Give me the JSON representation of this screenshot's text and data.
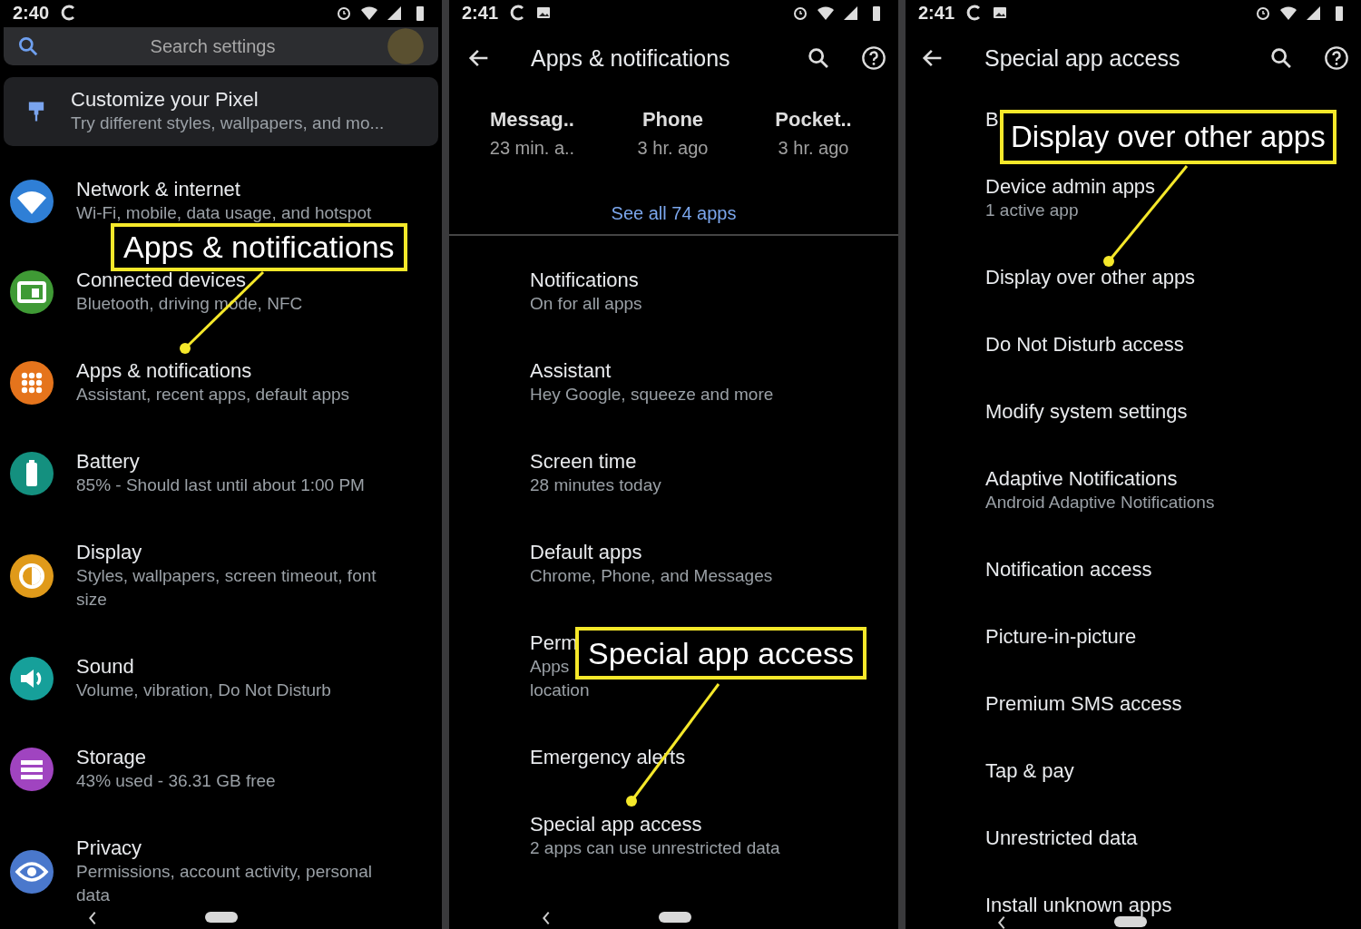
{
  "settings_screen": {
    "status_bar": {
      "time": "2:40"
    },
    "search": {
      "placeholder": "Search settings"
    },
    "banner": {
      "title": "Customize your Pixel",
      "subtitle": "Try different styles, wallpapers, and mo..."
    },
    "items": [
      {
        "title": "Network & internet",
        "subtitle": "Wi-Fi, mobile, data usage, and hotspot",
        "color": "#2f7fd6"
      },
      {
        "title": "Connected devices",
        "subtitle": "Bluetooth, driving mode, NFC",
        "color": "#3f9a35"
      },
      {
        "title": "Apps & notifications",
        "subtitle": "Assistant, recent apps, default apps",
        "color": "#e5741c"
      },
      {
        "title": "Battery",
        "subtitle": "85% - Should last until about 1:00 PM",
        "color": "#14907f"
      },
      {
        "title": "Display",
        "subtitle": "Styles, wallpapers, screen timeout, font size",
        "color": "#e09a1a"
      },
      {
        "title": "Sound",
        "subtitle": "Volume, vibration, Do Not Disturb",
        "color": "#16a09a"
      },
      {
        "title": "Storage",
        "subtitle": "43% used - 36.31 GB free",
        "color": "#a044c0"
      },
      {
        "title": "Privacy",
        "subtitle": "Permissions, account activity, personal data",
        "color": "#4a78cc"
      }
    ]
  },
  "apps_screen": {
    "status_bar": {
      "time": "2:41"
    },
    "title": "Apps & notifications",
    "recent_apps": [
      {
        "name": "Messag..",
        "time": "23 min. a.."
      },
      {
        "name": "Phone",
        "time": "3 hr. ago"
      },
      {
        "name": "Pocket..",
        "time": "3 hr. ago"
      }
    ],
    "see_all": "See all 74 apps",
    "items": [
      {
        "title": "Notifications",
        "subtitle": "On for all apps"
      },
      {
        "title": "Assistant",
        "subtitle": "Hey Google, squeeze and more"
      },
      {
        "title": "Screen time",
        "subtitle": "28 minutes today"
      },
      {
        "title": "Default apps",
        "subtitle": "Chrome, Phone, and Messages"
      },
      {
        "title": "Perm",
        "subtitle": "Apps\nlocation"
      },
      {
        "title": "Emergency alerts"
      },
      {
        "title": "Special app access",
        "subtitle": "2 apps can use unrestricted data"
      }
    ]
  },
  "special_access_screen": {
    "status_bar": {
      "time": "2:41"
    },
    "title": "Special app access",
    "items": [
      {
        "title": "B"
      },
      {
        "title": "Device admin apps",
        "subtitle": "1 active app"
      },
      {
        "title": "Display over other apps"
      },
      {
        "title": "Do Not Disturb access"
      },
      {
        "title": "Modify system settings"
      },
      {
        "title": "Adaptive Notifications",
        "subtitle": "Android Adaptive Notifications"
      },
      {
        "title": "Notification access"
      },
      {
        "title": "Picture-in-picture"
      },
      {
        "title": "Premium SMS access"
      },
      {
        "title": "Tap & pay"
      },
      {
        "title": "Unrestricted data"
      },
      {
        "title": "Install unknown apps"
      }
    ]
  },
  "callouts": [
    {
      "text": "Apps & notifications"
    },
    {
      "text": "Special app access"
    },
    {
      "text": "Display over other apps"
    }
  ]
}
